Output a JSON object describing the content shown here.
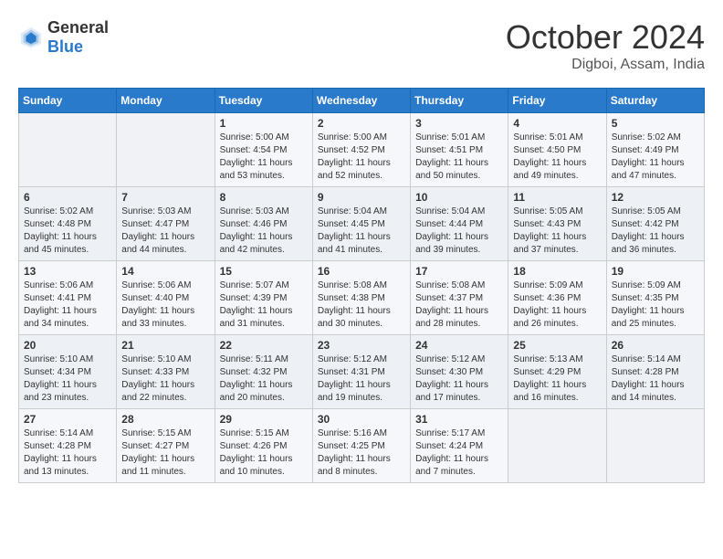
{
  "header": {
    "logo_general": "General",
    "logo_blue": "Blue",
    "month": "October 2024",
    "location": "Digboi, Assam, India"
  },
  "weekdays": [
    "Sunday",
    "Monday",
    "Tuesday",
    "Wednesday",
    "Thursday",
    "Friday",
    "Saturday"
  ],
  "weeks": [
    [
      {
        "day": "",
        "sunrise": "",
        "sunset": "",
        "daylight": ""
      },
      {
        "day": "",
        "sunrise": "",
        "sunset": "",
        "daylight": ""
      },
      {
        "day": "1",
        "sunrise": "Sunrise: 5:00 AM",
        "sunset": "Sunset: 4:54 PM",
        "daylight": "Daylight: 11 hours and 53 minutes."
      },
      {
        "day": "2",
        "sunrise": "Sunrise: 5:00 AM",
        "sunset": "Sunset: 4:52 PM",
        "daylight": "Daylight: 11 hours and 52 minutes."
      },
      {
        "day": "3",
        "sunrise": "Sunrise: 5:01 AM",
        "sunset": "Sunset: 4:51 PM",
        "daylight": "Daylight: 11 hours and 50 minutes."
      },
      {
        "day": "4",
        "sunrise": "Sunrise: 5:01 AM",
        "sunset": "Sunset: 4:50 PM",
        "daylight": "Daylight: 11 hours and 49 minutes."
      },
      {
        "day": "5",
        "sunrise": "Sunrise: 5:02 AM",
        "sunset": "Sunset: 4:49 PM",
        "daylight": "Daylight: 11 hours and 47 minutes."
      }
    ],
    [
      {
        "day": "6",
        "sunrise": "Sunrise: 5:02 AM",
        "sunset": "Sunset: 4:48 PM",
        "daylight": "Daylight: 11 hours and 45 minutes."
      },
      {
        "day": "7",
        "sunrise": "Sunrise: 5:03 AM",
        "sunset": "Sunset: 4:47 PM",
        "daylight": "Daylight: 11 hours and 44 minutes."
      },
      {
        "day": "8",
        "sunrise": "Sunrise: 5:03 AM",
        "sunset": "Sunset: 4:46 PM",
        "daylight": "Daylight: 11 hours and 42 minutes."
      },
      {
        "day": "9",
        "sunrise": "Sunrise: 5:04 AM",
        "sunset": "Sunset: 4:45 PM",
        "daylight": "Daylight: 11 hours and 41 minutes."
      },
      {
        "day": "10",
        "sunrise": "Sunrise: 5:04 AM",
        "sunset": "Sunset: 4:44 PM",
        "daylight": "Daylight: 11 hours and 39 minutes."
      },
      {
        "day": "11",
        "sunrise": "Sunrise: 5:05 AM",
        "sunset": "Sunset: 4:43 PM",
        "daylight": "Daylight: 11 hours and 37 minutes."
      },
      {
        "day": "12",
        "sunrise": "Sunrise: 5:05 AM",
        "sunset": "Sunset: 4:42 PM",
        "daylight": "Daylight: 11 hours and 36 minutes."
      }
    ],
    [
      {
        "day": "13",
        "sunrise": "Sunrise: 5:06 AM",
        "sunset": "Sunset: 4:41 PM",
        "daylight": "Daylight: 11 hours and 34 minutes."
      },
      {
        "day": "14",
        "sunrise": "Sunrise: 5:06 AM",
        "sunset": "Sunset: 4:40 PM",
        "daylight": "Daylight: 11 hours and 33 minutes."
      },
      {
        "day": "15",
        "sunrise": "Sunrise: 5:07 AM",
        "sunset": "Sunset: 4:39 PM",
        "daylight": "Daylight: 11 hours and 31 minutes."
      },
      {
        "day": "16",
        "sunrise": "Sunrise: 5:08 AM",
        "sunset": "Sunset: 4:38 PM",
        "daylight": "Daylight: 11 hours and 30 minutes."
      },
      {
        "day": "17",
        "sunrise": "Sunrise: 5:08 AM",
        "sunset": "Sunset: 4:37 PM",
        "daylight": "Daylight: 11 hours and 28 minutes."
      },
      {
        "day": "18",
        "sunrise": "Sunrise: 5:09 AM",
        "sunset": "Sunset: 4:36 PM",
        "daylight": "Daylight: 11 hours and 26 minutes."
      },
      {
        "day": "19",
        "sunrise": "Sunrise: 5:09 AM",
        "sunset": "Sunset: 4:35 PM",
        "daylight": "Daylight: 11 hours and 25 minutes."
      }
    ],
    [
      {
        "day": "20",
        "sunrise": "Sunrise: 5:10 AM",
        "sunset": "Sunset: 4:34 PM",
        "daylight": "Daylight: 11 hours and 23 minutes."
      },
      {
        "day": "21",
        "sunrise": "Sunrise: 5:10 AM",
        "sunset": "Sunset: 4:33 PM",
        "daylight": "Daylight: 11 hours and 22 minutes."
      },
      {
        "day": "22",
        "sunrise": "Sunrise: 5:11 AM",
        "sunset": "Sunset: 4:32 PM",
        "daylight": "Daylight: 11 hours and 20 minutes."
      },
      {
        "day": "23",
        "sunrise": "Sunrise: 5:12 AM",
        "sunset": "Sunset: 4:31 PM",
        "daylight": "Daylight: 11 hours and 19 minutes."
      },
      {
        "day": "24",
        "sunrise": "Sunrise: 5:12 AM",
        "sunset": "Sunset: 4:30 PM",
        "daylight": "Daylight: 11 hours and 17 minutes."
      },
      {
        "day": "25",
        "sunrise": "Sunrise: 5:13 AM",
        "sunset": "Sunset: 4:29 PM",
        "daylight": "Daylight: 11 hours and 16 minutes."
      },
      {
        "day": "26",
        "sunrise": "Sunrise: 5:14 AM",
        "sunset": "Sunset: 4:28 PM",
        "daylight": "Daylight: 11 hours and 14 minutes."
      }
    ],
    [
      {
        "day": "27",
        "sunrise": "Sunrise: 5:14 AM",
        "sunset": "Sunset: 4:28 PM",
        "daylight": "Daylight: 11 hours and 13 minutes."
      },
      {
        "day": "28",
        "sunrise": "Sunrise: 5:15 AM",
        "sunset": "Sunset: 4:27 PM",
        "daylight": "Daylight: 11 hours and 11 minutes."
      },
      {
        "day": "29",
        "sunrise": "Sunrise: 5:15 AM",
        "sunset": "Sunset: 4:26 PM",
        "daylight": "Daylight: 11 hours and 10 minutes."
      },
      {
        "day": "30",
        "sunrise": "Sunrise: 5:16 AM",
        "sunset": "Sunset: 4:25 PM",
        "daylight": "Daylight: 11 hours and 8 minutes."
      },
      {
        "day": "31",
        "sunrise": "Sunrise: 5:17 AM",
        "sunset": "Sunset: 4:24 PM",
        "daylight": "Daylight: 11 hours and 7 minutes."
      },
      {
        "day": "",
        "sunrise": "",
        "sunset": "",
        "daylight": ""
      },
      {
        "day": "",
        "sunrise": "",
        "sunset": "",
        "daylight": ""
      }
    ]
  ]
}
